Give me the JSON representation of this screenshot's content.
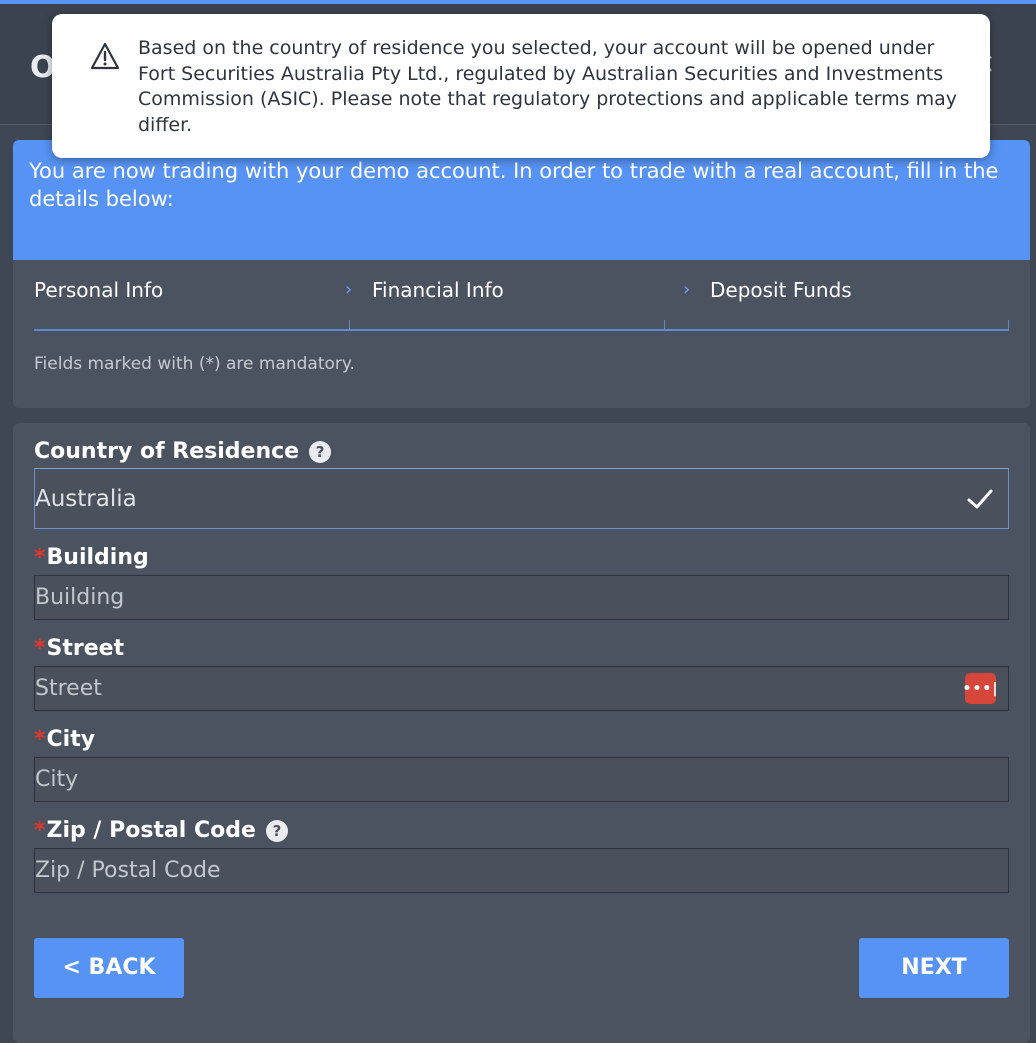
{
  "header": {
    "initial": "O",
    "close_glyph": "✕"
  },
  "toast": {
    "icon": "warning-icon",
    "message": "Based on the country of residence you selected, your account will be opened under Fort Securities Australia Pty Ltd., regulated by Australian Securities and Investments Commission (ASIC). Please note that regulatory protections and applicable terms may differ."
  },
  "banner": {
    "text": "You are now trading with your demo account. In order to trade with a real account, fill in the details below:"
  },
  "steps": [
    {
      "label": "Personal Info"
    },
    {
      "label": "Financial Info"
    },
    {
      "label": "Deposit Funds"
    }
  ],
  "mandatory_note": "Fields marked with (*) are mandatory.",
  "form": {
    "country": {
      "label": "Country of Residence",
      "value": "Australia",
      "help": "?"
    },
    "building": {
      "required_mark": "*",
      "label": "Building",
      "placeholder": "Building"
    },
    "street": {
      "required_mark": "*",
      "label": "Street",
      "placeholder": "Street",
      "pw_icon": "•••|"
    },
    "city": {
      "required_mark": "*",
      "label": "City",
      "placeholder": "City"
    },
    "zip": {
      "required_mark": "*",
      "label": "Zip / Postal Code",
      "placeholder": "Zip / Postal Code",
      "help": "?"
    }
  },
  "buttons": {
    "back": "< BACK",
    "next": "NEXT"
  },
  "colors": {
    "accent": "#5793f5",
    "required": "#e0362c",
    "panel": "#4c5360",
    "background": "#3f4654"
  }
}
